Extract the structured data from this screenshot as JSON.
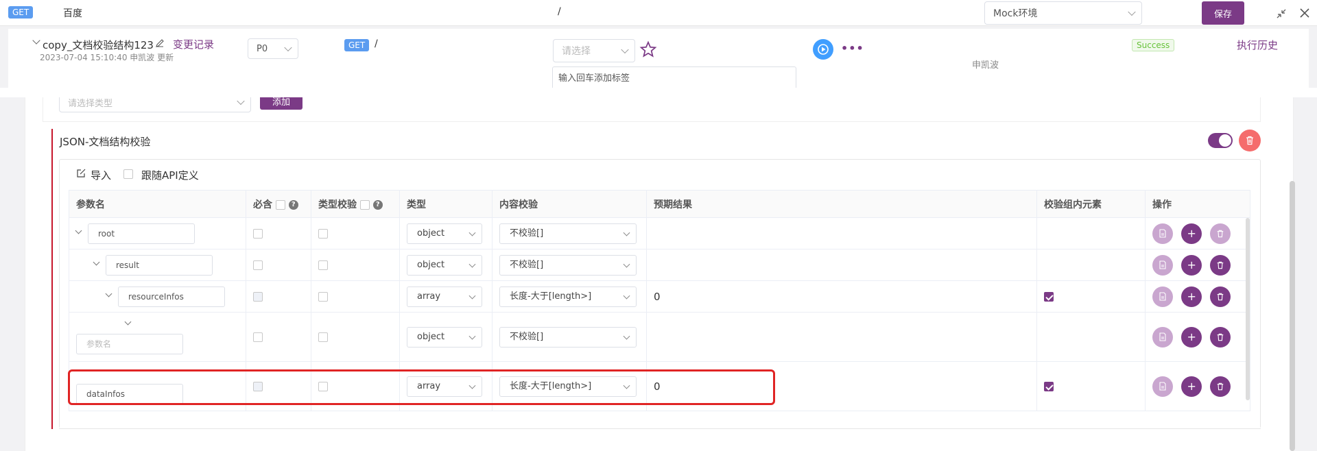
{
  "topbar": {
    "method": "GET",
    "name": "百度",
    "path": "/",
    "env": "Mock环境",
    "save": "保存"
  },
  "header": {
    "title": "copy_文档校验结构123",
    "change_log": "变更记录",
    "meta": "2023-07-04 15:10:40 申凯波 更新",
    "priority": "P0",
    "method": "GET",
    "path": "/",
    "status_placeholder": "请选择",
    "tag_placeholder": "输入回车添加标签",
    "status": "Success",
    "history": "执行历史",
    "user": "申凯波"
  },
  "partial": {
    "type_placeholder": "请选择类型",
    "add": "添加"
  },
  "section": {
    "title": "JSON-文档结构校验",
    "import": "导入",
    "follow_api": "跟随API定义"
  },
  "table": {
    "headers": [
      "参数名",
      "必含",
      "类型校验",
      "类型",
      "内容校验",
      "预期结果",
      "校验组内元素",
      "操作"
    ],
    "rows": [
      {
        "name": "root",
        "type": "object",
        "content": "不校验[]",
        "expected": ""
      },
      {
        "name": "result",
        "type": "object",
        "content": "不校验[]",
        "expected": ""
      },
      {
        "name": "resourceInfos",
        "type": "array",
        "content": "长度-大于[length>]",
        "expected": "0"
      },
      {
        "name": "参数名",
        "type": "object",
        "content": "不校验[]",
        "expected": ""
      },
      {
        "name": "dataInfos",
        "type": "array",
        "content": "长度-大于[length>]",
        "expected": "0"
      }
    ]
  },
  "colors": {
    "accent": "#7b3a86",
    "danger": "#e02424",
    "success": "#67c23a",
    "get": "#5b9cf0"
  }
}
